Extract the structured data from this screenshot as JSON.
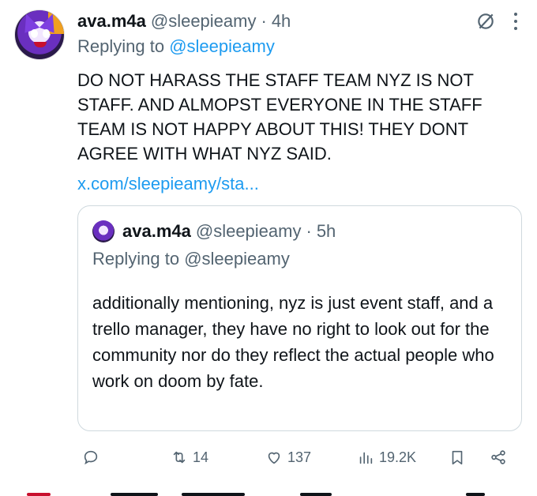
{
  "tweet": {
    "display_name": "ava.m4a",
    "handle": "@sleepieamy",
    "separator": "·",
    "time": "4h",
    "replying_prefix": "Replying to",
    "replying_to": "@sleepieamy",
    "text": "DO NOT HARASS THE STAFF TEAM NYZ IS NOT STAFF. AND ALMOPST EVERYONE IN THE STAFF TEAM IS NOT HAPPY ABOUT THIS! THEY DONT AGREE WITH WHAT NYZ SAID.",
    "link": "x.com/sleepieamy/sta..."
  },
  "quote": {
    "display_name": "ava.m4a",
    "handle": "@sleepieamy",
    "separator": "·",
    "time": "5h",
    "replying_prefix": "Replying to",
    "replying_to": "@sleepieamy",
    "text": "additionally mentioning, nyz is just event staff, and a trello manager, they have no right to look out for the community nor do they reflect the actual people who work on doom by fate."
  },
  "actions": {
    "reposts": "14",
    "likes": "137",
    "views": "19.2K"
  },
  "icons": [
    "grok-icon",
    "more-icon",
    "reply-icon",
    "retweet-icon",
    "like-icon",
    "views-icon",
    "bookmark-icon",
    "share-icon"
  ],
  "colors": {
    "link": "#1d9bf0",
    "muted": "#536471",
    "text": "#0f1419",
    "retweet": "#00ba7c"
  }
}
